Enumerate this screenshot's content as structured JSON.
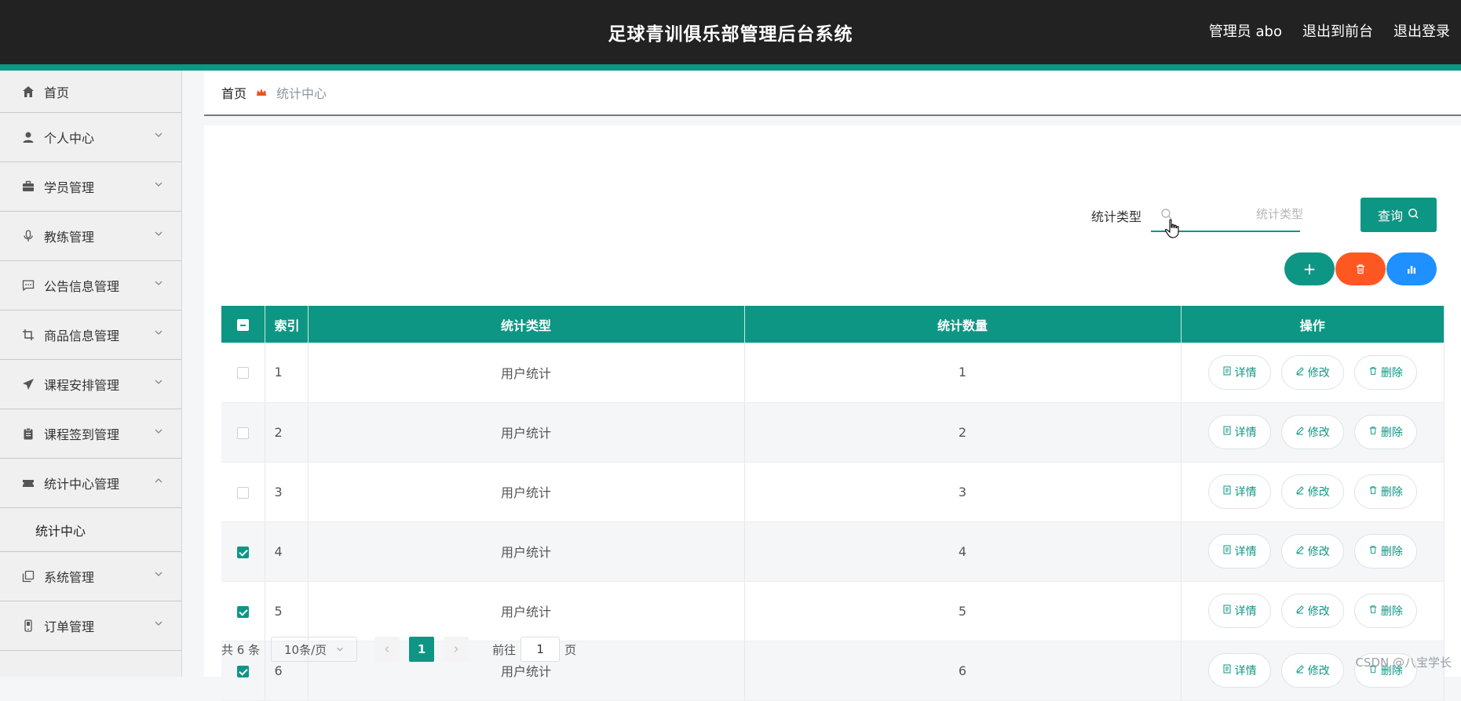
{
  "header": {
    "title": "足球青训俱乐部管理后台系统",
    "admin_label": "管理员 abo",
    "back_to_front": "退出到前台",
    "logout": "退出登录"
  },
  "sidebar": {
    "items": [
      {
        "label": "首页",
        "icon": "home-icon"
      },
      {
        "label": "个人中心",
        "icon": "user-icon"
      },
      {
        "label": "学员管理",
        "icon": "briefcase-icon"
      },
      {
        "label": "教练管理",
        "icon": "microphone-icon"
      },
      {
        "label": "公告信息管理",
        "icon": "message-icon"
      },
      {
        "label": "商品信息管理",
        "icon": "crop-icon"
      },
      {
        "label": "课程安排管理",
        "icon": "send-icon"
      },
      {
        "label": "课程签到管理",
        "icon": "clipboard-icon"
      },
      {
        "label": "统计中心管理",
        "icon": "ticket-icon"
      },
      {
        "label": "系统管理",
        "icon": "copy-icon"
      },
      {
        "label": "订单管理",
        "icon": "phone-icon"
      }
    ],
    "sub_active": "统计中心"
  },
  "breadcrumb": {
    "home": "首页",
    "current": "统计中心"
  },
  "search": {
    "label": "统计类型",
    "placeholder": "统计类型",
    "query_button": "查询"
  },
  "actions": {
    "add": "+"
  },
  "table": {
    "headers": [
      "索引",
      "统计类型",
      "统计数量",
      "操作"
    ],
    "rows": [
      {
        "index": "1",
        "type": "用户统计",
        "count": "1",
        "checked": false
      },
      {
        "index": "2",
        "type": "用户统计",
        "count": "2",
        "checked": false
      },
      {
        "index": "3",
        "type": "用户统计",
        "count": "3",
        "checked": false
      },
      {
        "index": "4",
        "type": "用户统计",
        "count": "4",
        "checked": true
      },
      {
        "index": "5",
        "type": "用户统计",
        "count": "5",
        "checked": true
      },
      {
        "index": "6",
        "type": "用户统计",
        "count": "6",
        "checked": true
      }
    ],
    "ops": {
      "detail": "详情",
      "edit": "修改",
      "delete": "删除"
    }
  },
  "pagination": {
    "total": "共 6 条",
    "page_size": "10条/页",
    "current_page": "1",
    "goto_prefix": "前往",
    "goto_value": "1",
    "goto_suffix": "页"
  },
  "watermark": "CSDN @八宝学长",
  "colors": {
    "accent": "#0e9684",
    "danger": "#ff5722",
    "info": "#1e90ff",
    "topbar": "#222222"
  }
}
